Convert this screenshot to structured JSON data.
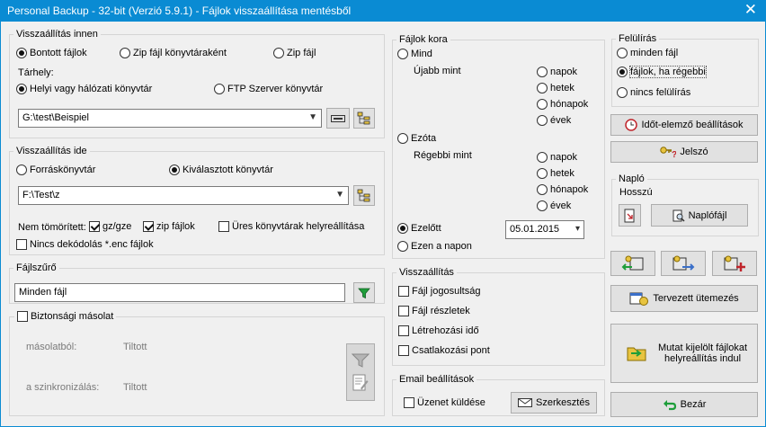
{
  "window": {
    "title": "Personal Backup - 32-bit (Verzió 5.9.1) - Fájlok visszaállítása mentésből",
    "close_glyph": "✕"
  },
  "restore_from": {
    "legend": "Visszaállítás innen",
    "source_options": [
      {
        "label": "Bontott fájlok",
        "selected": true
      },
      {
        "label": "Zip fájl könyvtáraként",
        "selected": false
      },
      {
        "label": "Zip fájl",
        "selected": false
      }
    ],
    "storage_label": "Tárhely:",
    "storage_options": [
      {
        "label": "Helyi vagy hálózati könyvtár",
        "selected": true
      },
      {
        "label": "FTP Szerver könyvtár",
        "selected": false
      }
    ],
    "path_value": "G:\\test\\Beispiel"
  },
  "restore_to": {
    "legend": "Visszaállítás ide",
    "target_options": [
      {
        "label": "Forráskönyvtár",
        "selected": false
      },
      {
        "label": "Kiválasztott könyvtár",
        "selected": true
      }
    ],
    "path_value": "F:\\Test\\z",
    "uncompressed_label": "Nem tömörített:",
    "gz_label": "gz/gze",
    "gz_checked": true,
    "zip_label": "zip fájlok",
    "zip_checked": true,
    "empty_dirs_label": "Üres könyvtárak helyreállítása",
    "empty_dirs_checked": false,
    "no_decode_label": "Nincs dekódolás *.enc fájlok",
    "no_decode_checked": false
  },
  "file_filter": {
    "legend": "Fájlszűrő",
    "value": "Minden fájl"
  },
  "backup_copy": {
    "label": "Biztonsági másolat",
    "checked": false,
    "from_label": "másolatból:",
    "from_value": "Tiltott",
    "sync_label": "a szinkronizálás:",
    "sync_value": "Tiltott"
  },
  "file_age": {
    "legend": "Fájlok kora",
    "all_label": "Mind",
    "all_selected": false,
    "newer_label": "Újabb mint",
    "units": [
      "napok",
      "hetek",
      "hónapok",
      "évek"
    ],
    "since_label": "Ezóta",
    "since_selected": false,
    "older_label": "Régebbi mint",
    "before_label": "Ezelőtt",
    "before_selected": true,
    "before_date": "05.01.2015",
    "on_day_label": "Ezen a napon",
    "on_day_selected": false
  },
  "restore_options": {
    "legend": "Visszaállítás",
    "items": [
      {
        "label": "Fájl jogosultság",
        "checked": false
      },
      {
        "label": "Fájl részletek",
        "checked": false
      },
      {
        "label": "Létrehozási idő",
        "checked": false
      },
      {
        "label": "Csatlakozási pont",
        "checked": false
      }
    ]
  },
  "email": {
    "legend": "Email beállítások",
    "send_label": "Üzenet küldése",
    "send_checked": false,
    "edit_button": "Szerkesztés"
  },
  "overwrite": {
    "legend": "Felülírás",
    "options": [
      {
        "label": "minden fájl",
        "selected": false
      },
      {
        "label": "fájlok, ha régebbi",
        "selected": true
      },
      {
        "label": "nincs felülírás",
        "selected": false
      }
    ]
  },
  "buttons": {
    "timezone": "Időt-elemző beállítások",
    "password": "Jelszó",
    "schedule": "Tervezett ütemezés",
    "restore_marked": "Mutat kijelölt fájlokat\nhelyreállítás indul",
    "close": "Bezár"
  },
  "log": {
    "legend": "Napló",
    "length_label": "Hosszú",
    "logfile_button": "Naplófájl"
  },
  "colors": {
    "titlebar": "#0a8bd3",
    "window_bg": "#f0f0f0",
    "filter_icon": "#1e9e3a",
    "close_icon": "#1e9e3a"
  }
}
